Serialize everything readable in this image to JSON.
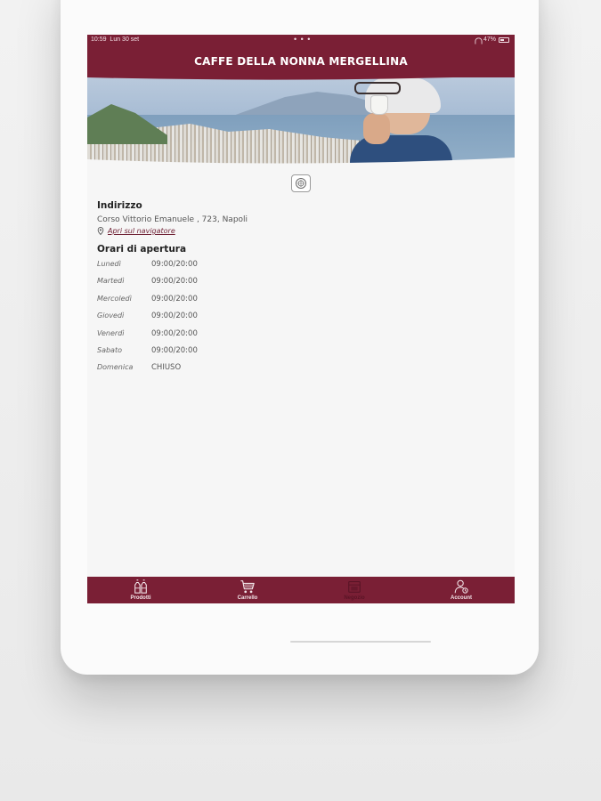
{
  "status_bar": {
    "time": "10:59",
    "date": "Lun 30 set",
    "dots": "• • •",
    "battery": "47%"
  },
  "header": {
    "title": "CAFFE DELLA NONNA MERGELLINA"
  },
  "address": {
    "section_title": "Indirizzo",
    "text": "Corso Vittorio Emanuele , 723, Napoli",
    "nav_link": "Apri sul navigatore"
  },
  "hours": {
    "section_title": "Orari di apertura",
    "rows": [
      {
        "day": "Lunedì",
        "time": "09:00/20:00"
      },
      {
        "day": "Martedì",
        "time": "09:00/20:00"
      },
      {
        "day": "Mercoledì",
        "time": "09:00/20:00"
      },
      {
        "day": "Giovedì",
        "time": "09:00/20:00"
      },
      {
        "day": "Venerdì",
        "time": "09:00/20:00"
      },
      {
        "day": "Sabato",
        "time": "09:00/20:00"
      },
      {
        "day": "Domenica",
        "time": "CHIUSO"
      }
    ]
  },
  "tab_bar": {
    "items": [
      {
        "label": "Prodotti",
        "icon": "products-icon",
        "active": false
      },
      {
        "label": "Carrello",
        "icon": "cart-icon",
        "active": false
      },
      {
        "label": "Negozio",
        "icon": "store-icon",
        "active": true
      },
      {
        "label": "Account",
        "icon": "account-icon",
        "active": false
      }
    ]
  },
  "colors": {
    "brand": "#7a1f35",
    "background": "#f6f6f6"
  }
}
